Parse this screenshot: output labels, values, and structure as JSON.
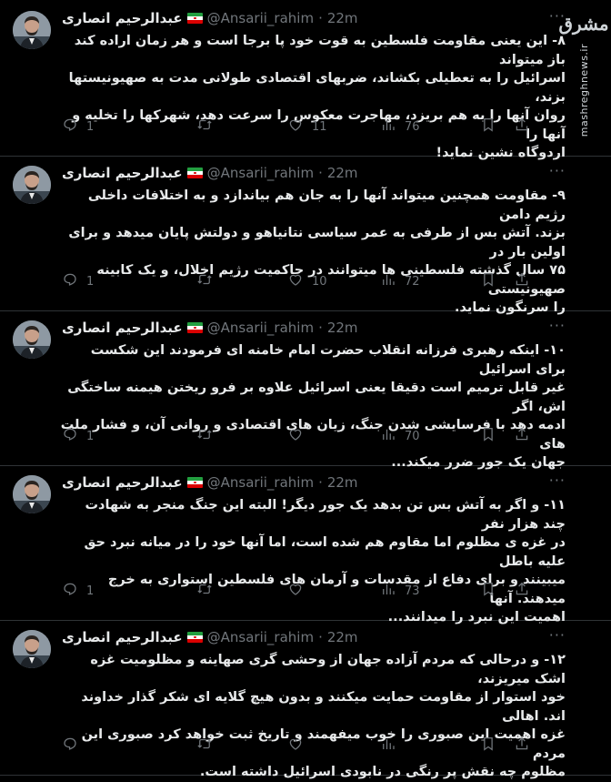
{
  "author": {
    "name": "عبدالرحیم انصاری",
    "handle": "@Ansarii_rahim",
    "separator": "·",
    "flag_icon": "iran-flag-icon"
  },
  "watermark": {
    "logo": "مشرق",
    "url": "mashreghnews.ir"
  },
  "more_label": "···",
  "tweets": [
    {
      "time": "22m",
      "lines": [
        "۸- این یعنی مقاومت فلسطین به قوت خود پا برجا است و هر زمان اراده کند باز میتواند",
        "اسرائیل را به تعطیلی بکشاند، ضربهای اقتصادی طولانی مدت به صهیونیستها بزند،",
        "روان آنها را به هم بریزد، مهاجرت معکوس را سرعت دهد، شهرکها را تخلیه و آنها را",
        "اردوگاه نشین نماید!"
      ],
      "replies": "1",
      "retweets": "",
      "likes": "11",
      "views": "76"
    },
    {
      "time": "22m",
      "lines": [
        "۹- مقاومت همچنین میتواند آنها را به جان هم بیاندازد و به اختلافات داخلی رژیم دامن",
        "بزند. آتش بس از طرفی به عمر سیاسی نتانیاهو و دولتش پایان میدهد و برای اولین بار در",
        "۷۵ سال گذشته فلسطینی ها میتوانند در حاکمیت رژیم اخلال، و یک کابینه صهیونیستی",
        "را سرنگون نماید."
      ],
      "replies": "1",
      "retweets": "",
      "likes": "10",
      "views": "72"
    },
    {
      "time": "22m",
      "lines": [
        "۱۰- اینکه رهبری فرزانه انقلاب حضرت امام خامنه ای فرمودند این شکست برای اسرائیل",
        "غیر قابل ترمیم است دقیقا یعنی اسرائیل علاوه بر فرو ریختن هیمنه ساختگی اش، اگر",
        "ادمه دهد با فرسایشی شدن جنگ، زیان های اقتصادی و روانی آن، و فشار ملت های",
        "جهان یک جور ضرر میکند..."
      ],
      "replies": "1",
      "retweets": "",
      "likes": "",
      "views": "70"
    },
    {
      "time": "22m",
      "lines": [
        "۱۱- و اگر به آتش بس تن بدهد یک جور دیگر! البته این جنگ منجر به شهادت چند هزار نفر",
        "در غزه ی مظلوم اما مقاوم هم شده است، اما آنها خود را در میانه نبرد حق علیه باطل",
        "میبینند و برای دفاع از مقدسات و آرمان های فلسطین استواری به خرج میدهند. آنها",
        "اهمیت این نبرد را میدانند..."
      ],
      "replies": "1",
      "retweets": "",
      "likes": "",
      "views": "73"
    },
    {
      "time": "22m",
      "lines": [
        "۱۲- و درحالی که مردم آزاده جهان از وحشی گری صهاینه و مظلومیت غزه اشک میریزند،",
        "خود استوار از مقاومت حمایت میکنند و بدون هیچ گلایه ای شکر گذار خداوند اند. اهالی",
        "غزه اهمیت این صبوری را خوب میفهمند و تاریخ ثبت خواهد کرد صبوری این مردم",
        "مظلوم چه نقش پر رنگی در نابودی اسرائیل داشته است."
      ],
      "replies": "",
      "retweets": "",
      "likes": "",
      "views": ""
    }
  ]
}
